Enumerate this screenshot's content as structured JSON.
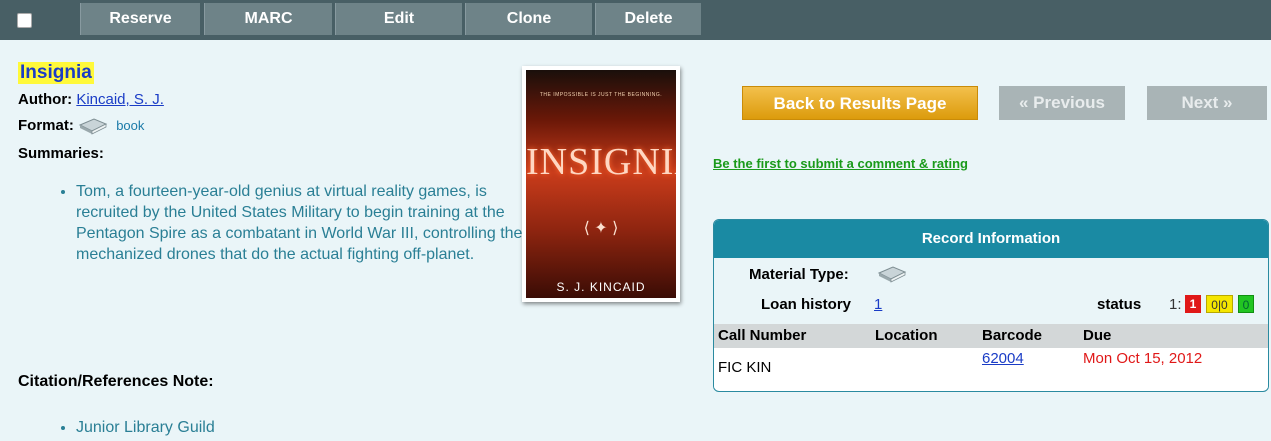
{
  "toolbar": {
    "buttons": [
      "Reserve",
      "MARC",
      "Edit",
      "Clone",
      "Delete"
    ]
  },
  "record": {
    "title": "Insignia",
    "author_label": "Author:",
    "author": "Kincaid, S. J.",
    "format_label": "Format:",
    "format": "book",
    "format_icon": "book-icon",
    "summaries_label": "Summaries:",
    "summary": "Tom, a fourteen-year-old genius at virtual reality games, is recruited by the United States Military to begin training at the Pentagon Spire as a combatant in World War III, controlling the mechanized drones that do the actual fighting off-planet.",
    "citation_label": "Citation/References Note:",
    "citation": "Junior Library Guild"
  },
  "cover": {
    "tagline": "THE IMPOSSIBLE IS JUST THE BEGINNING.",
    "title": "INSIGNIA",
    "author": "S. J. KINCAID"
  },
  "nav": {
    "back": "Back to Results Page",
    "previous": "« Previous",
    "next": "Next »"
  },
  "comment_link": "Be the first to submit a comment & rating",
  "record_info": {
    "header": "Record Information",
    "material_type_label": "Material Type:",
    "loan_history_label": "Loan history",
    "loan_history_value": "1",
    "status_label": "status",
    "status_num": "1:",
    "status_red": "1",
    "status_yellow": "0|0",
    "status_green": "0",
    "columns": [
      "Call Number",
      "Location",
      "Barcode",
      "Due"
    ],
    "row": {
      "call_number": "FIC KIN",
      "location": "",
      "barcode": "62004",
      "due": "Mon Oct 15, 2012"
    }
  },
  "colors": {
    "toolbar": "#485f65",
    "title_highlight": "#fff93a",
    "record_header": "#1a8aa3",
    "due_red": "#e01818"
  }
}
